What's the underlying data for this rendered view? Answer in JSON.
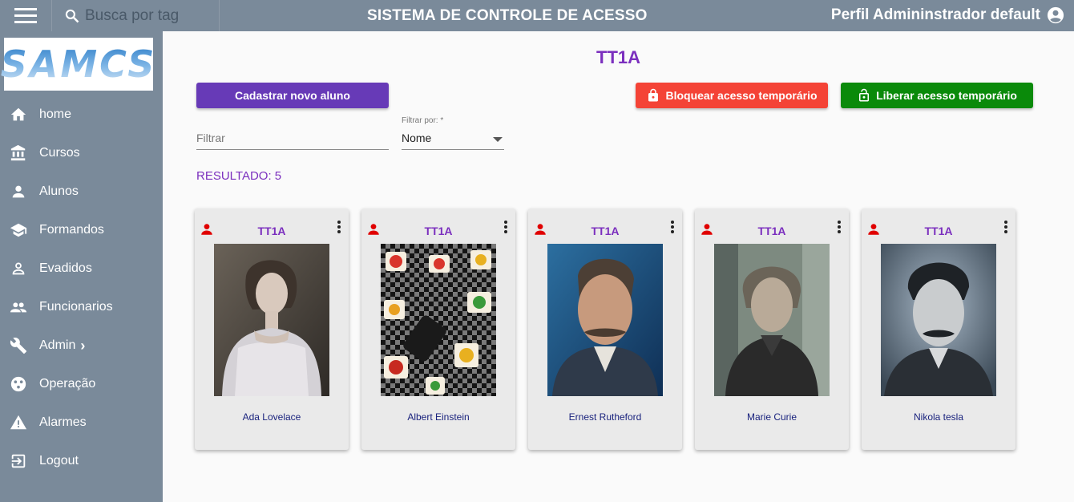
{
  "header": {
    "search_placeholder": "Busca por tag",
    "title": "SISTEMA DE CONTROLE DE ACESSO",
    "profile": "Perfil Admininstrador default"
  },
  "sidebar": {
    "logo": "SAMCS",
    "items": [
      {
        "label": "home",
        "icon": "home-icon"
      },
      {
        "label": "Cursos",
        "icon": "institution-icon"
      },
      {
        "label": "Alunos",
        "icon": "person-icon"
      },
      {
        "label": "Formandos",
        "icon": "graduation-cap-icon"
      },
      {
        "label": "Evadidos",
        "icon": "person-outline-icon"
      },
      {
        "label": "Funcionarios",
        "icon": "people-icon"
      },
      {
        "label": "Admin",
        "icon": "wrench-icon"
      },
      {
        "label": "Operação",
        "icon": "operation-icon"
      },
      {
        "label": "Alarmes",
        "icon": "warning-icon"
      },
      {
        "label": "Logout",
        "icon": "logout-icon"
      }
    ]
  },
  "main": {
    "title": "TT1A",
    "new_student_button": "Cadastrar novo aluno",
    "block_button": "Bloquear acesso temporário",
    "release_button": "Liberar acesso temporário",
    "filter_placeholder": "Filtrar",
    "filter_by_label": "Filtrar por: *",
    "filter_by_value": "Nome",
    "result": "RESULTADO: 5"
  },
  "cards": [
    {
      "class": "TT1A",
      "name": "Ada Lovelace"
    },
    {
      "class": "TT1A",
      "name": "Albert Einstein"
    },
    {
      "class": "TT1A",
      "name": "Ernest Rutheford"
    },
    {
      "class": "TT1A",
      "name": "Marie Curie"
    },
    {
      "class": "TT1A",
      "name": "Nikola tesla"
    }
  ],
  "colors": {
    "topbar": "#7a8a9a",
    "accent": "#7b2fbe",
    "primary_button": "#673ab7",
    "danger_button": "#f44336",
    "success_button": "#0a8a0a",
    "status_icon": "#e00000"
  }
}
